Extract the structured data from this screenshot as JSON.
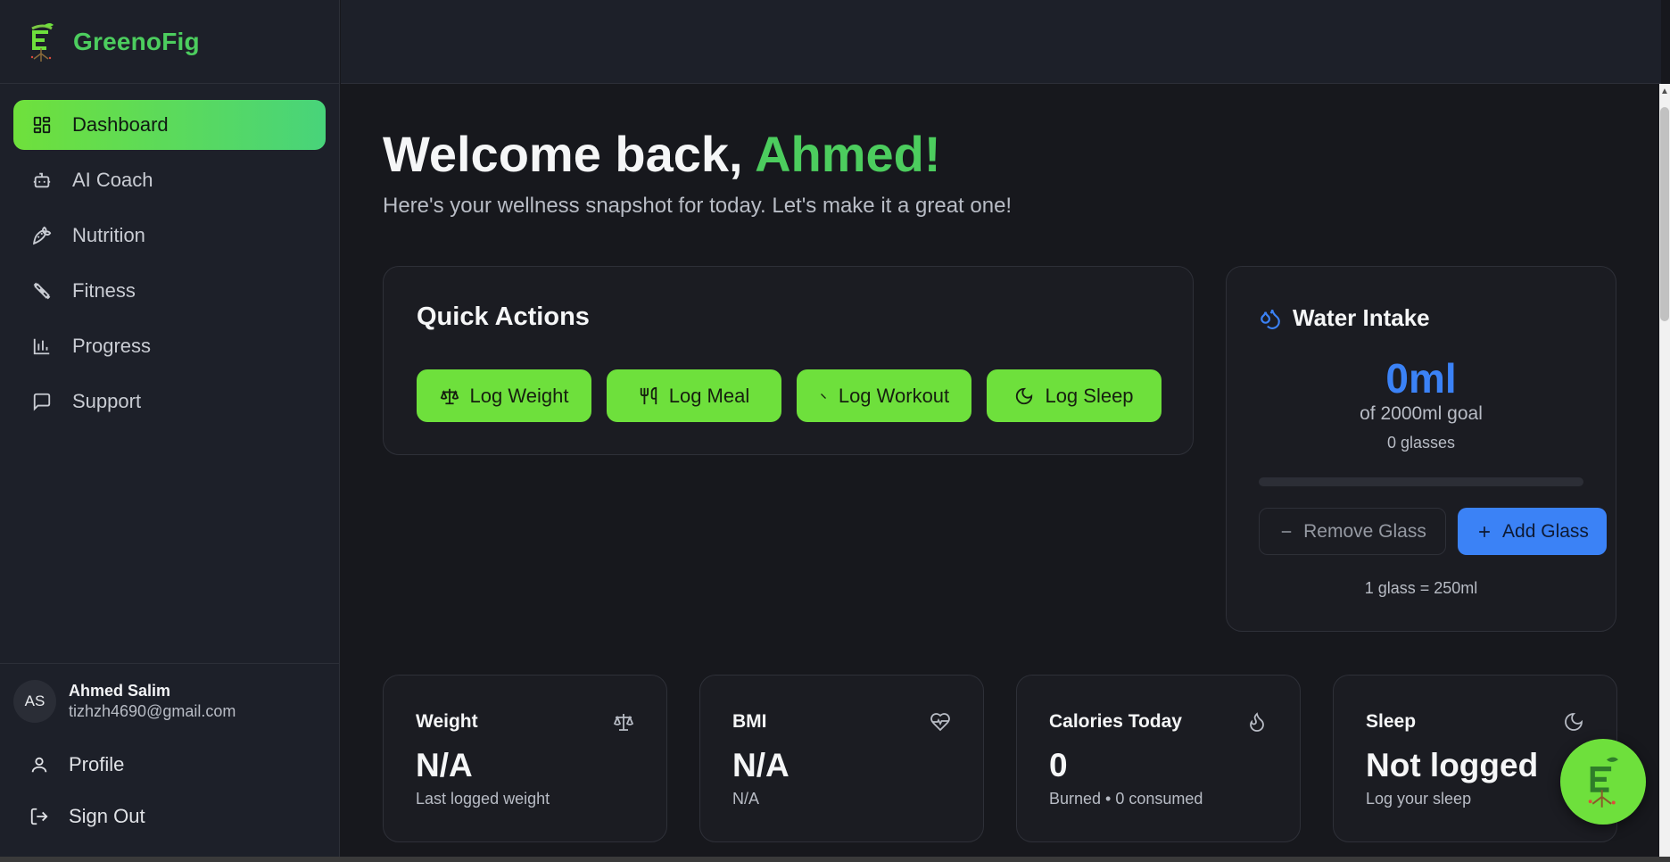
{
  "brand": {
    "name": "GreenoFig"
  },
  "sidebar": {
    "items": [
      {
        "label": "Dashboard",
        "icon": "grid-icon",
        "active": true
      },
      {
        "label": "AI Coach",
        "icon": "bot-icon",
        "active": false
      },
      {
        "label": "Nutrition",
        "icon": "carrot-icon",
        "active": false
      },
      {
        "label": "Fitness",
        "icon": "dumbbell-icon",
        "active": false
      },
      {
        "label": "Progress",
        "icon": "bar-chart-icon",
        "active": false
      },
      {
        "label": "Support",
        "icon": "message-icon",
        "active": false
      }
    ]
  },
  "user": {
    "initials": "AS",
    "name": "Ahmed Salim",
    "email": "tizhzh4690@gmail.com"
  },
  "account_links": {
    "profile": "Profile",
    "sign_out": "Sign Out"
  },
  "welcome": {
    "greeting": "Welcome back,",
    "name": "Ahmed!",
    "subtitle": "Here's your wellness snapshot for today. Let's make it a great one!"
  },
  "quick_actions": {
    "title": "Quick Actions",
    "buttons": [
      {
        "label": "Log Weight",
        "icon": "scale-icon"
      },
      {
        "label": "Log Meal",
        "icon": "utensils-icon"
      },
      {
        "label": "Log Workout",
        "icon": "dumbbell-icon"
      },
      {
        "label": "Log Sleep",
        "icon": "moon-icon"
      }
    ]
  },
  "water": {
    "title": "Water Intake",
    "amount": "0ml",
    "goal": "of 2000ml goal",
    "glasses": "0 glasses",
    "progress": 0,
    "remove_label": "Remove Glass",
    "add_label": "Add Glass",
    "note": "1 glass = 250ml"
  },
  "stats": [
    {
      "label": "Weight",
      "icon": "scale-icon",
      "value": "N/A",
      "sub": "Last logged weight"
    },
    {
      "label": "BMI",
      "icon": "heart-pulse-icon",
      "value": "N/A",
      "sub": "N/A"
    },
    {
      "label": "Calories Today",
      "icon": "flame-icon",
      "value": "0",
      "sub": "Burned • 0 consumed"
    },
    {
      "label": "Sleep",
      "icon": "moon-icon",
      "value": "Not logged",
      "sub": "Log your sleep"
    }
  ],
  "colors": {
    "brand_green": "#4ccd5e",
    "action_green": "#6ee03c",
    "water_blue": "#3b82f6",
    "background": "#17181d",
    "sidebar": "#1d2029"
  }
}
